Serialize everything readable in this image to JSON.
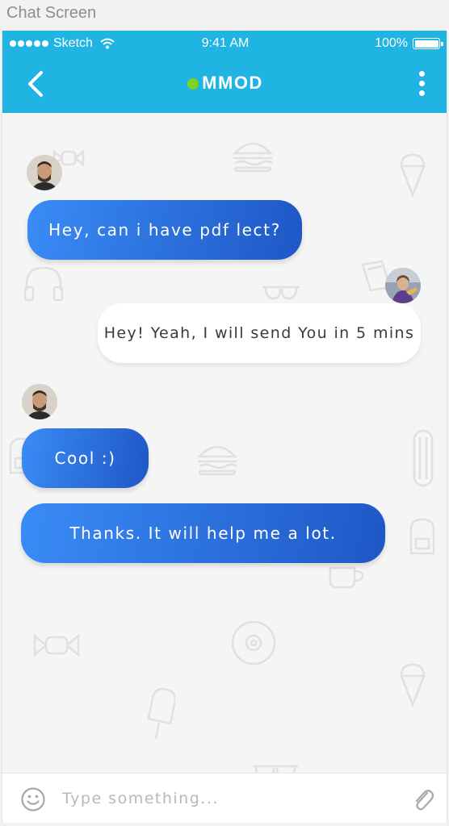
{
  "canvas": {
    "title": "Chat Screen"
  },
  "status_bar": {
    "carrier": "Sketch",
    "time": "9:41 AM",
    "battery": "100%"
  },
  "header": {
    "title": "MMOD",
    "online": true
  },
  "messages": [
    {
      "side": "incoming",
      "text": "Hey, can i have pdf lect?",
      "avatar": true
    },
    {
      "side": "outgoing",
      "text": "Hey! Yeah, I will send You in 5 mins",
      "avatar": true
    },
    {
      "side": "incoming",
      "text": "Cool :)",
      "avatar": true
    },
    {
      "side": "incoming",
      "text": "Thanks. It will help me a lot.",
      "avatar": false
    }
  ],
  "composer": {
    "placeholder": "Type something...",
    "value": ""
  },
  "icons": {
    "back": "chevron-left-icon",
    "more": "more-vertical-icon",
    "emoji": "smiley-icon",
    "attach": "paperclip-icon"
  },
  "colors": {
    "header": "#1fb4e2",
    "online": "#7ed321",
    "incoming_bubble_start": "#3a8cf7",
    "incoming_bubble_end": "#1e57c6",
    "outgoing_bubble": "#ffffff"
  }
}
